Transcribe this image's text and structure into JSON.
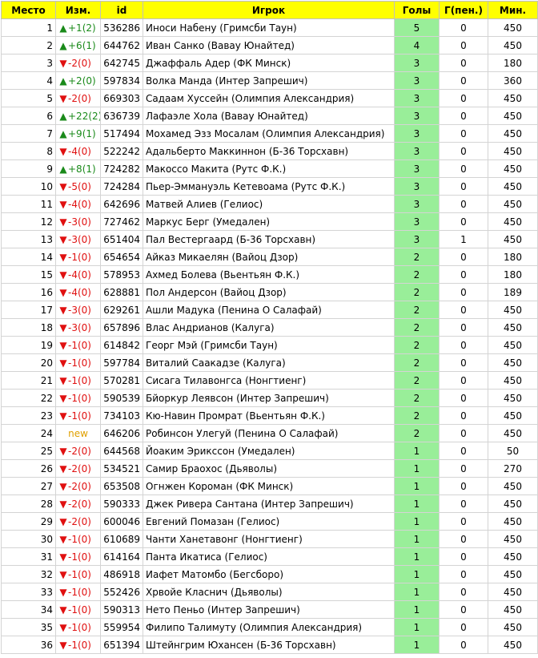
{
  "headers": {
    "place": "Место",
    "change": "Изм.",
    "id": "id",
    "player": "Игрок",
    "goals": "Голы",
    "pen": "Г(пен.)",
    "min": "Мин."
  },
  "colors": {
    "header_bg": "#ffff00",
    "goals_bg": "#99ee99",
    "up": "#1a8a1a",
    "down": "#e01010",
    "new": "#e0a000"
  },
  "rows": [
    {
      "place": "1",
      "dir": "up",
      "arrow": "▲",
      "change": "+1(2)",
      "id": "536286",
      "player": "Иноси Набену (Гримсби Таун)",
      "goals": "5",
      "pen": "0",
      "min": "450"
    },
    {
      "place": "2",
      "dir": "up",
      "arrow": "▲",
      "change": "+6(1)",
      "id": "644762",
      "player": "Иван Санко (Вавау Юнайтед)",
      "goals": "4",
      "pen": "0",
      "min": "450"
    },
    {
      "place": "3",
      "dir": "down",
      "arrow": "▼",
      "change": "-2(0)",
      "id": "642745",
      "player": "Джаффаль Адер (ФК Минск)",
      "goals": "3",
      "pen": "0",
      "min": "180"
    },
    {
      "place": "4",
      "dir": "up",
      "arrow": "▲",
      "change": "+2(0)",
      "id": "597834",
      "player": "Волка Манда (Интер Запрешич)",
      "goals": "3",
      "pen": "0",
      "min": "360"
    },
    {
      "place": "5",
      "dir": "down",
      "arrow": "▼",
      "change": "-2(0)",
      "id": "669303",
      "player": "Садаам Хуссейн (Олимпия Александрия)",
      "goals": "3",
      "pen": "0",
      "min": "450"
    },
    {
      "place": "6",
      "dir": "up",
      "arrow": "▲",
      "change": "+22(2)",
      "id": "636739",
      "player": "Лафаэле Хола (Вавау Юнайтед)",
      "goals": "3",
      "pen": "0",
      "min": "450"
    },
    {
      "place": "7",
      "dir": "up",
      "arrow": "▲",
      "change": "+9(1)",
      "id": "517494",
      "player": "Мохамед Эзз Мосалам (Олимпия Александрия)",
      "goals": "3",
      "pen": "0",
      "min": "450"
    },
    {
      "place": "8",
      "dir": "down",
      "arrow": "▼",
      "change": "-4(0)",
      "id": "522242",
      "player": "Адальберто Маккиннон (Б-36 Торсхавн)",
      "goals": "3",
      "pen": "0",
      "min": "450"
    },
    {
      "place": "9",
      "dir": "up",
      "arrow": "▲",
      "change": "+8(1)",
      "id": "724282",
      "player": "Макоссо Макита (Рутс Ф.К.)",
      "goals": "3",
      "pen": "0",
      "min": "450"
    },
    {
      "place": "10",
      "dir": "down",
      "arrow": "▼",
      "change": "-5(0)",
      "id": "724284",
      "player": "Пьер-Эммануэль Кетевоама (Рутс Ф.К.)",
      "goals": "3",
      "pen": "0",
      "min": "450"
    },
    {
      "place": "11",
      "dir": "down",
      "arrow": "▼",
      "change": "-4(0)",
      "id": "642696",
      "player": "Матвей Алиев (Гелиос)",
      "goals": "3",
      "pen": "0",
      "min": "450"
    },
    {
      "place": "12",
      "dir": "down",
      "arrow": "▼",
      "change": "-3(0)",
      "id": "727462",
      "player": "Маркус Берг (Умедален)",
      "goals": "3",
      "pen": "0",
      "min": "450"
    },
    {
      "place": "13",
      "dir": "down",
      "arrow": "▼",
      "change": "-3(0)",
      "id": "651404",
      "player": "Пал Вестергаард (Б-36 Торсхавн)",
      "goals": "3",
      "pen": "1",
      "min": "450"
    },
    {
      "place": "14",
      "dir": "down",
      "arrow": "▼",
      "change": "-1(0)",
      "id": "654654",
      "player": "Айказ Микаелян (Вайоц Дзор)",
      "goals": "2",
      "pen": "0",
      "min": "180"
    },
    {
      "place": "15",
      "dir": "down",
      "arrow": "▼",
      "change": "-4(0)",
      "id": "578953",
      "player": "Ахмед Болева (Вьентьян Ф.К.)",
      "goals": "2",
      "pen": "0",
      "min": "180"
    },
    {
      "place": "16",
      "dir": "down",
      "arrow": "▼",
      "change": "-4(0)",
      "id": "628881",
      "player": "Пол Андерсон (Вайоц Дзор)",
      "goals": "2",
      "pen": "0",
      "min": "189"
    },
    {
      "place": "17",
      "dir": "down",
      "arrow": "▼",
      "change": "-3(0)",
      "id": "629261",
      "player": "Ашли Мадука (Пенина О Салафай)",
      "goals": "2",
      "pen": "0",
      "min": "450"
    },
    {
      "place": "18",
      "dir": "down",
      "arrow": "▼",
      "change": "-3(0)",
      "id": "657896",
      "player": "Влас Андрианов (Калуга)",
      "goals": "2",
      "pen": "0",
      "min": "450"
    },
    {
      "place": "19",
      "dir": "down",
      "arrow": "▼",
      "change": "-1(0)",
      "id": "614842",
      "player": "Георг Мэй (Гримсби Таун)",
      "goals": "2",
      "pen": "0",
      "min": "450"
    },
    {
      "place": "20",
      "dir": "down",
      "arrow": "▼",
      "change": "-1(0)",
      "id": "597784",
      "player": "Виталий Саакадзе (Калуга)",
      "goals": "2",
      "pen": "0",
      "min": "450"
    },
    {
      "place": "21",
      "dir": "down",
      "arrow": "▼",
      "change": "-1(0)",
      "id": "570281",
      "player": "Сисага Тилавонгса (Нонгтиенг)",
      "goals": "2",
      "pen": "0",
      "min": "450"
    },
    {
      "place": "22",
      "dir": "down",
      "arrow": "▼",
      "change": "-1(0)",
      "id": "590539",
      "player": "Бйоркур Леявсон (Интер Запрешич)",
      "goals": "2",
      "pen": "0",
      "min": "450"
    },
    {
      "place": "23",
      "dir": "down",
      "arrow": "▼",
      "change": "-1(0)",
      "id": "734103",
      "player": "Кю-Навин Промрат (Вьентьян Ф.К.)",
      "goals": "2",
      "pen": "0",
      "min": "450"
    },
    {
      "place": "24",
      "dir": "new",
      "arrow": "",
      "change": "new",
      "id": "646206",
      "player": "Робинсон Улегуй (Пенина О Салафай)",
      "goals": "2",
      "pen": "0",
      "min": "450"
    },
    {
      "place": "25",
      "dir": "down",
      "arrow": "▼",
      "change": "-2(0)",
      "id": "644568",
      "player": "Йоаким Эрикссон (Умедален)",
      "goals": "1",
      "pen": "0",
      "min": "50"
    },
    {
      "place": "26",
      "dir": "down",
      "arrow": "▼",
      "change": "-2(0)",
      "id": "534521",
      "player": "Самир Браохос (Дьяволы)",
      "goals": "1",
      "pen": "0",
      "min": "270"
    },
    {
      "place": "27",
      "dir": "down",
      "arrow": "▼",
      "change": "-2(0)",
      "id": "653508",
      "player": "Огнжен Короман (ФК Минск)",
      "goals": "1",
      "pen": "0",
      "min": "450"
    },
    {
      "place": "28",
      "dir": "down",
      "arrow": "▼",
      "change": "-2(0)",
      "id": "590333",
      "player": "Джек Ривера Сантана (Интер Запрешич)",
      "goals": "1",
      "pen": "0",
      "min": "450"
    },
    {
      "place": "29",
      "dir": "down",
      "arrow": "▼",
      "change": "-2(0)",
      "id": "600046",
      "player": "Евгений Помазан (Гелиос)",
      "goals": "1",
      "pen": "0",
      "min": "450"
    },
    {
      "place": "30",
      "dir": "down",
      "arrow": "▼",
      "change": "-1(0)",
      "id": "610689",
      "player": "Чанти Ханетавонг (Нонгтиенг)",
      "goals": "1",
      "pen": "0",
      "min": "450"
    },
    {
      "place": "31",
      "dir": "down",
      "arrow": "▼",
      "change": "-1(0)",
      "id": "614164",
      "player": "Панта Икатиса (Гелиос)",
      "goals": "1",
      "pen": "0",
      "min": "450"
    },
    {
      "place": "32",
      "dir": "down",
      "arrow": "▼",
      "change": "-1(0)",
      "id": "486918",
      "player": "Иафет Матомбо (Бегсборо)",
      "goals": "1",
      "pen": "0",
      "min": "450"
    },
    {
      "place": "33",
      "dir": "down",
      "arrow": "▼",
      "change": "-1(0)",
      "id": "552426",
      "player": "Хрвойе Класнич (Дьяволы)",
      "goals": "1",
      "pen": "0",
      "min": "450"
    },
    {
      "place": "34",
      "dir": "down",
      "arrow": "▼",
      "change": "-1(0)",
      "id": "590313",
      "player": "Нето Пеньо (Интер Запрешич)",
      "goals": "1",
      "pen": "0",
      "min": "450"
    },
    {
      "place": "35",
      "dir": "down",
      "arrow": "▼",
      "change": "-1(0)",
      "id": "559954",
      "player": "Филипо Талимуту (Олимпия Александрия)",
      "goals": "1",
      "pen": "0",
      "min": "450"
    },
    {
      "place": "36",
      "dir": "down",
      "arrow": "▼",
      "change": "-1(0)",
      "id": "651394",
      "player": "Штейнгрим Юхансен (Б-36 Торсхавн)",
      "goals": "1",
      "pen": "0",
      "min": "450"
    }
  ]
}
